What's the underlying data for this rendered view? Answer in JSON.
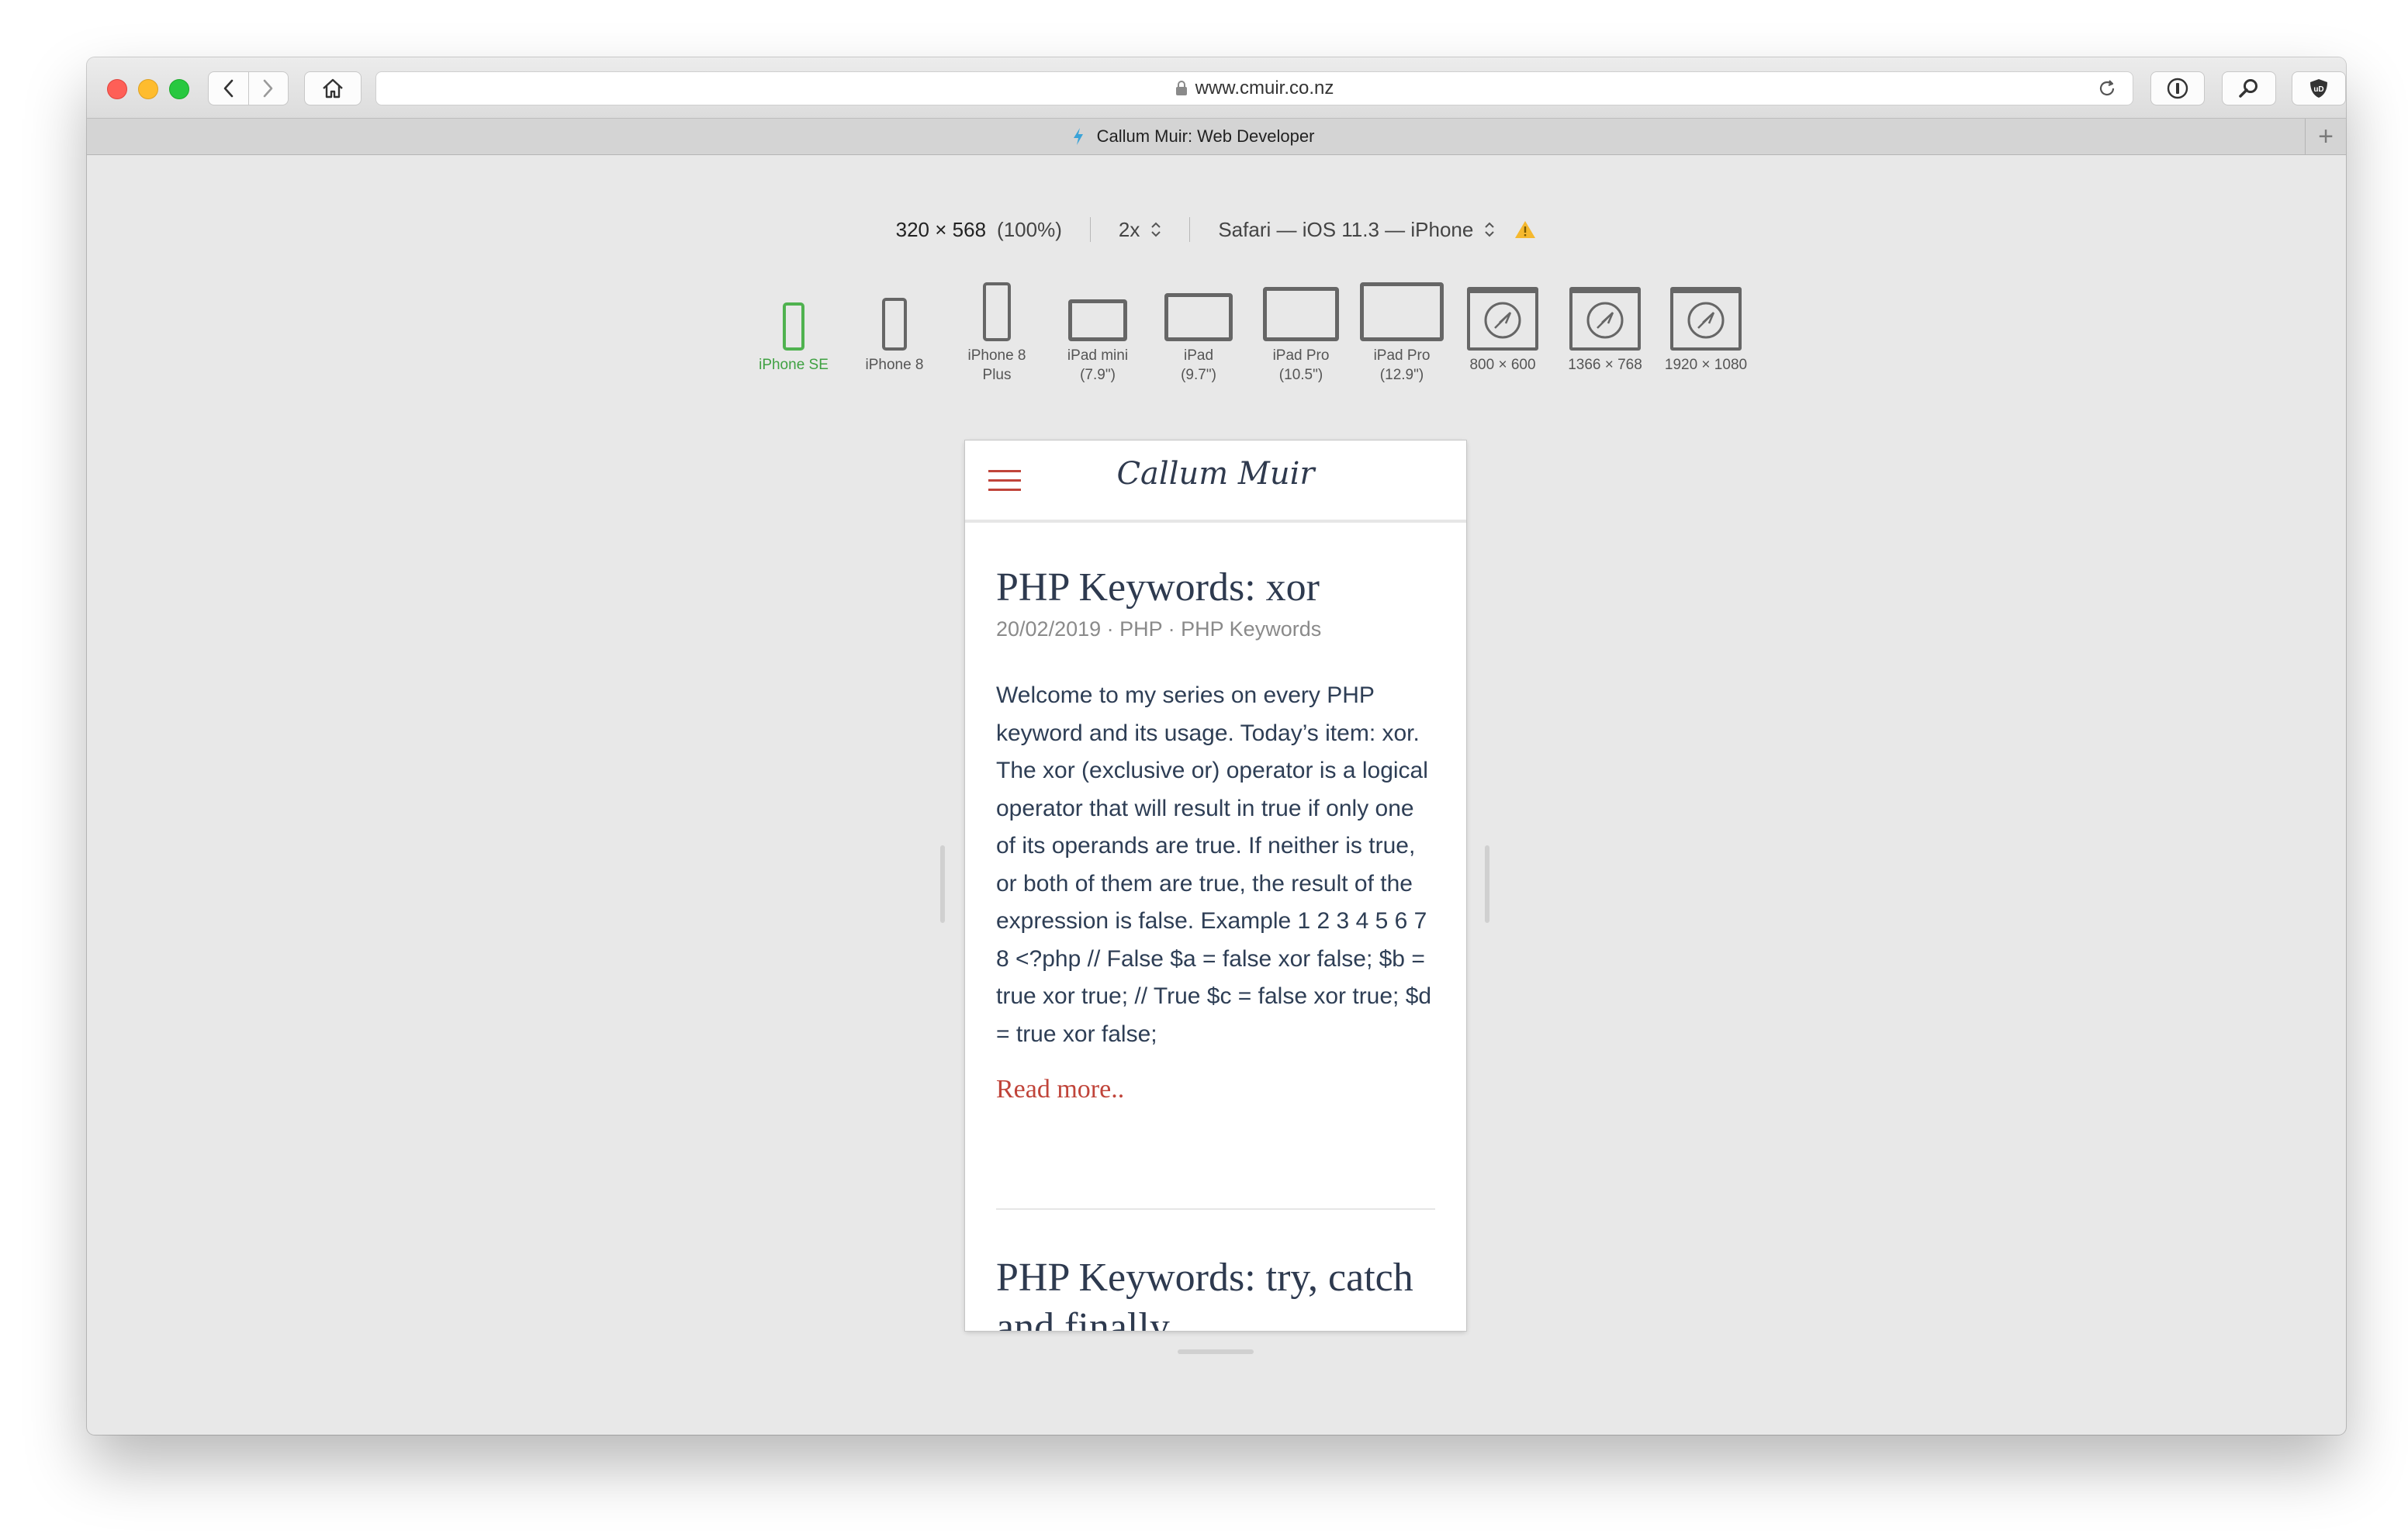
{
  "browser": {
    "url": "www.cmuir.co.nz",
    "tab_title": "Callum Muir: Web Developer",
    "new_tab_label": "+"
  },
  "responsive": {
    "size": "320 × 568",
    "zoom": "(100%)",
    "scale": "2x",
    "user_agent": "Safari — iOS 11.3 — iPhone",
    "devices": [
      {
        "label": "iPhone SE",
        "active": true,
        "icon": "phone-small-icon"
      },
      {
        "label": "iPhone 8",
        "active": false,
        "icon": "phone-icon"
      },
      {
        "label": "iPhone 8\nPlus",
        "active": false,
        "icon": "phone-large-icon"
      },
      {
        "label": "iPad mini\n(7.9\")",
        "active": false,
        "icon": "tablet-small-icon"
      },
      {
        "label": "iPad\n(9.7\")",
        "active": false,
        "icon": "tablet-icon"
      },
      {
        "label": "iPad Pro\n(10.5\")",
        "active": false,
        "icon": "tablet-large-icon"
      },
      {
        "label": "iPad Pro\n(12.9\")",
        "active": false,
        "icon": "tablet-xlarge-icon"
      },
      {
        "label": "800 × 600",
        "active": false,
        "icon": "compass-window-icon"
      },
      {
        "label": "1366 × 768",
        "active": false,
        "icon": "compass-window-icon"
      },
      {
        "label": "1920 × 1080",
        "active": false,
        "icon": "compass-window-icon"
      }
    ],
    "colors": {
      "active_device": "#3fa142",
      "warning": "#f5b82e"
    }
  },
  "site": {
    "title": "Callum Muir",
    "accent": "#c0443a",
    "posts": [
      {
        "title": "PHP Keywords: xor",
        "meta": "20/02/2019 · PHP · PHP Keywords",
        "excerpt": "Welcome to my series on every PHP keyword and its usage. Today’s item: xor. The xor (exclusive or) operator is a logical operator that will result in true if only one of its operands are true. If neither is true, or both of them are true, the result of the expression is false. Example 1 2 3 4 5 6 7 8 <?php // False $a = false xor false; $b = true xor true; // True $c = false xor true; $d = true xor false;",
        "read_more": "Read more.."
      },
      {
        "title": "PHP Keywords: try, catch",
        "title_cont": "and finally"
      }
    ]
  }
}
